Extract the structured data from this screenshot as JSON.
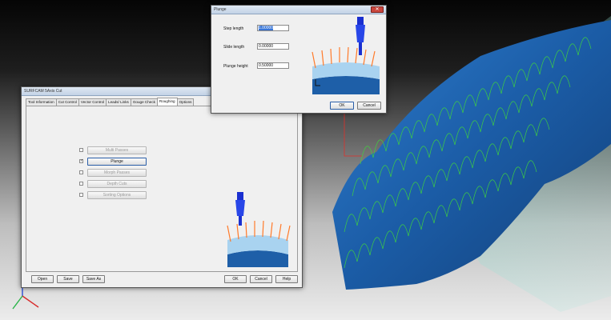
{
  "main_dialog": {
    "title": "SURFCAM 5Axis Cut",
    "tabs": [
      {
        "label": "Tool Information"
      },
      {
        "label": "Cut Control"
      },
      {
        "label": "Vector Control"
      },
      {
        "label": "Leads/ Links"
      },
      {
        "label": "Gouge Check"
      },
      {
        "label": "Roughing",
        "active": true
      },
      {
        "label": "Options"
      }
    ],
    "options": [
      {
        "label": "Multi Passes",
        "checked": false,
        "enabled": false
      },
      {
        "label": "Plunge",
        "checked": true,
        "enabled": true
      },
      {
        "label": "Morph Passes",
        "checked": false,
        "enabled": false
      },
      {
        "label": "Depth Cuts",
        "checked": false,
        "enabled": false
      },
      {
        "label": "Sorting Options",
        "checked": false,
        "enabled": false
      }
    ],
    "buttons": {
      "open": "Open",
      "save": "Save",
      "save_as": "Save As",
      "ok": "OK",
      "cancel": "Cancel",
      "help": "Help"
    }
  },
  "plunge_dialog": {
    "title": "Plunge",
    "fields": {
      "step_length": {
        "label": "Step length",
        "value": "1.00000"
      },
      "slide_length": {
        "label": "Slide length",
        "value": "0.00000"
      },
      "plunge_height": {
        "label": "Plunge height",
        "value": "0.50000"
      }
    },
    "buttons": {
      "ok": "OK",
      "cancel": "Cancel"
    }
  },
  "icons": [
    "close-icon",
    "check-mark-icon",
    "tool-holder-icon",
    "axis-triad-icon"
  ],
  "colors": {
    "toolpath_green": "#3fd23f",
    "surface_blue": "#1e5fa8",
    "tool_blue": "#1a2fd0",
    "vector_orange": "#ff7a2a"
  }
}
